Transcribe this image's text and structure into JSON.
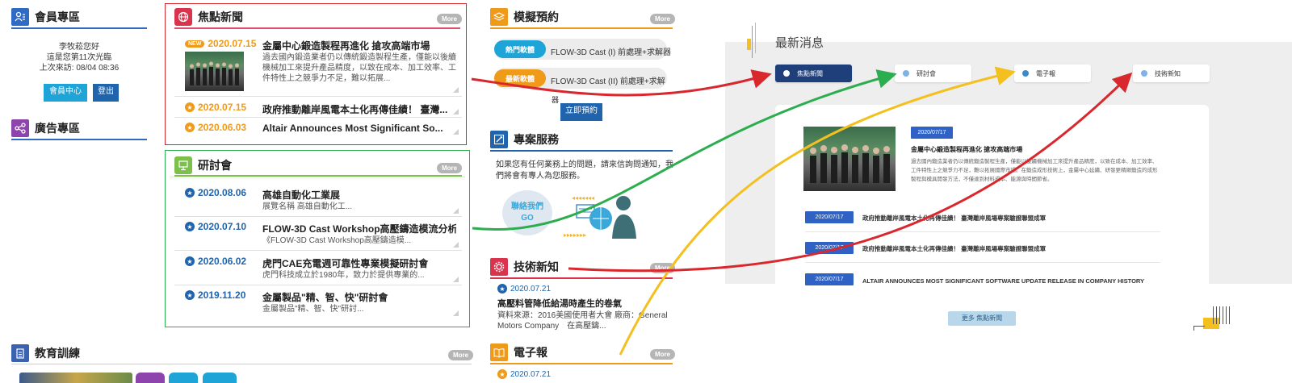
{
  "member": {
    "title": "會員專區",
    "greeting": "李牧菘您好",
    "visit_count": "這是您第11次光臨",
    "last_visit": "上次來訪: 08/04 08:36",
    "member_center_label": "會員中心",
    "logout_label": "登出"
  },
  "ads": {
    "title": "廣告專區"
  },
  "focus_news": {
    "title": "焦點新聞",
    "more_label": "More",
    "new_badge": "NEW",
    "items": [
      {
        "date": "2020.07.15",
        "title": "金屬中心鍛造製程再進化 搶攻高端市場",
        "desc": "過去國內鍛造業者仍以傳統鍛造製程生產，僅能以後續機械加工來提升產品精度，以致在成本、加工效率、工件特性上之競爭力不足，難以拓展..."
      },
      {
        "date": "2020.07.15",
        "title": "政府推動離岸風電本土化再傳佳績！ 臺灣..."
      },
      {
        "date": "2020.06.03",
        "title": "Altair Announces Most Significant So..."
      }
    ]
  },
  "seminar": {
    "title": "研討會",
    "more_label": "More",
    "items": [
      {
        "date": "2020.08.06",
        "title": "高雄自動化工業展",
        "desc": "展覽名稱 高雄自動化工..."
      },
      {
        "date": "2020.07.10",
        "title": "FLOW-3D Cast Workshop高壓鑄造模流分析...",
        "desc": "《FLOW-3D Cast Workshop高壓鑄造模..."
      },
      {
        "date": "2020.06.02",
        "title": "虎門CAE充電週可靠性專業模擬研討會",
        "desc": "虎門科技成立於1980年，致力於提供專業的..."
      },
      {
        "date": "2019.11.20",
        "title": "金屬製品\"精、智、快\"研討會",
        "desc": "金屬製品\"精、智、快\"研討..."
      }
    ]
  },
  "education": {
    "title": "教育訓練",
    "more_label": "More"
  },
  "reservation": {
    "title": "模擬預約",
    "more_label": "More",
    "rows": [
      {
        "tag": "熱門軟體",
        "text": "FLOW-3D Cast (I) 前處理+求解器"
      },
      {
        "tag": "最新軟體",
        "text": "FLOW-3D Cast (II) 前處理+求解"
      }
    ],
    "stray_text": "器",
    "book_label": "立即預約"
  },
  "project": {
    "title": "專案服務",
    "desc": "如果您有任何業務上的問題，請來信詢問通知，我們將會有專人為您服務。",
    "contact_label": "聯絡我們 GO"
  },
  "tech": {
    "title": "技術新知",
    "more_label": "More",
    "date": "2020.07.21",
    "headline": "高壓料管降低給湯時產生的卷氣",
    "desc": "資料來源：2016美國使用者大會 廠商：General Motors Company　在高壓鑄..."
  },
  "enews": {
    "title": "電子報",
    "more_label": "More",
    "date": "2020.07.21"
  },
  "redesign": {
    "title": "最新消息",
    "tabs": [
      "焦點新聞",
      "研討會",
      "電子報",
      "技術新知"
    ],
    "feature_date": "2020/07/17",
    "feature_title": "金屬中心鍛造製程再進化 搶攻高端市場",
    "feature_desc": "過去國內鍛造業者仍以傳統鍛造製程生產，僅能以後續機械加工來提升產品精度，以致在成本、加工效率、工件特性上之競爭力不足，難以拓展國際市場。在鍛造成形技術上，金屬中心延續、研發更精緻鍛造的成形製程與模具開發方法，不僅達到材料成本、能源與時間節省。",
    "list": [
      {
        "date": "2020/07/17",
        "title": "政府推動離岸風電本土化再傳佳績！ 臺灣離岸風場專案驗證聯盟成軍"
      },
      {
        "date": "2020/07/17",
        "title": "政府推動離岸風電本土化再傳佳績！ 臺灣離岸風場專案驗證聯盟成軍"
      },
      {
        "date": "2020/07/17",
        "title": "ALTAIR ANNOUNCES MOST SIGNIFICANT SOFTWARE UPDATE RELEASE IN COMPANY HISTORY"
      }
    ],
    "more_label": "更多 焦點新聞"
  },
  "colors": {
    "arrow_red": "#d9272e",
    "arrow_green": "#2cad4f",
    "arrow_yellow": "#f4c01f",
    "accent_blue": "#1f64ad",
    "focus_border": "#d9272e",
    "seminar_border": "#2cad4f",
    "orange": "#ef9a18",
    "teal": "#1fa4d8",
    "navy": "#1f3f7a"
  },
  "icons": [
    "member-icon",
    "globe-icon",
    "share-icon",
    "presentation-icon",
    "clipboard-icon",
    "layers-icon",
    "pencil-icon",
    "gear-icon",
    "book-icon",
    "star-icon"
  ]
}
